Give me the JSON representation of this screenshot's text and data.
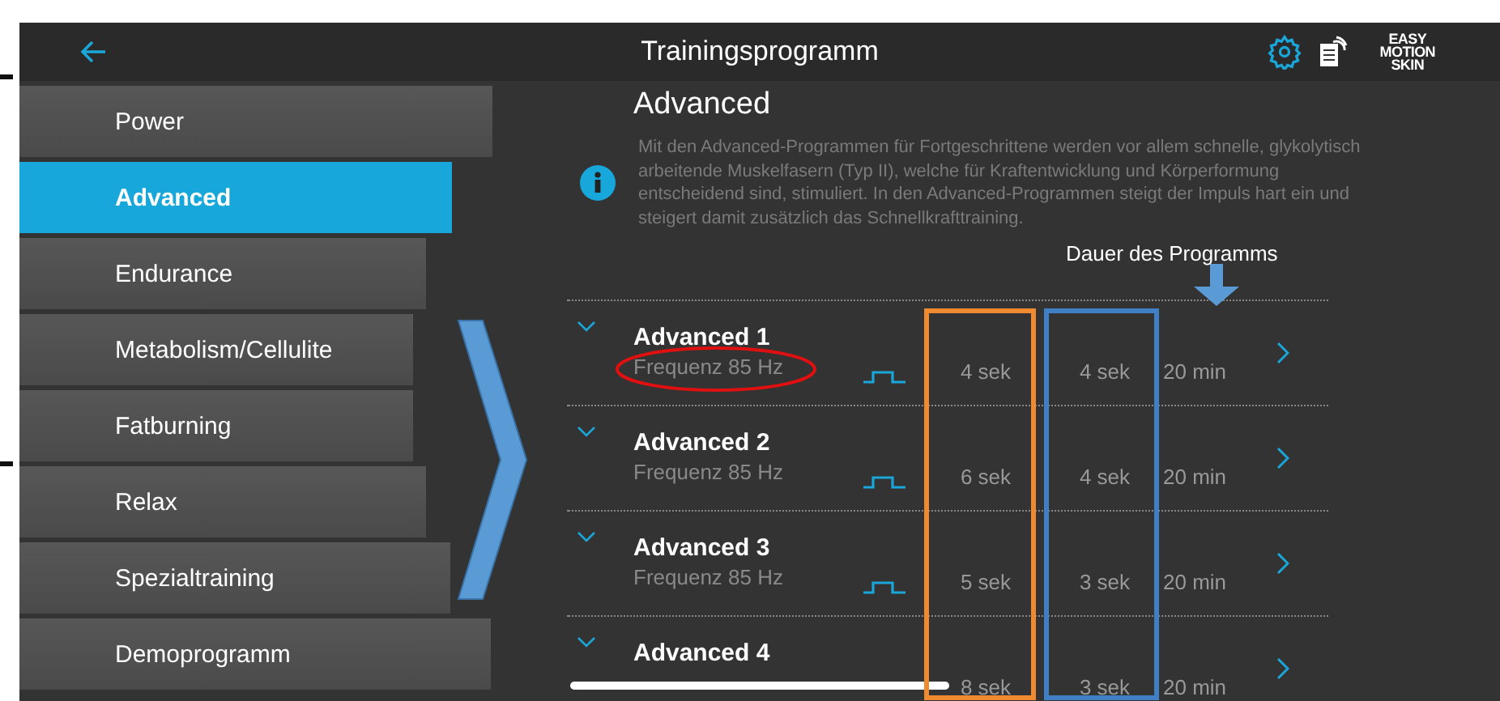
{
  "header": {
    "title": "Trainingsprogramm",
    "logo": [
      "EASY",
      "MOTION",
      "SKIN"
    ]
  },
  "sidebar": {
    "items": [
      {
        "label": "Power",
        "selected": false
      },
      {
        "label": "Advanced",
        "selected": true
      },
      {
        "label": "Endurance",
        "selected": false
      },
      {
        "label": "Metabolism/Cellulite",
        "selected": false
      },
      {
        "label": "Fatburning",
        "selected": false
      },
      {
        "label": "Relax",
        "selected": false
      },
      {
        "label": "Spezialtraining",
        "selected": false
      },
      {
        "label": "Demoprogramm",
        "selected": false
      }
    ]
  },
  "content": {
    "title": "Advanced",
    "description": "Mit den Advanced-Programmen für Fortgeschrittene werden vor allem schnelle, glykolytisch arbeitende Muskelfasern (Typ II), welche für Kraftentwicklung und Körperformung entscheidend sind, stimuliert. In den Advanced-Programmen steigt der Impuls hart ein und steigert damit zusätzlich das Schnellkrafttraining.",
    "programs": [
      {
        "name": "Advanced 1",
        "frequency": "Frequenz 85 Hz",
        "value_1": "4 sek",
        "value_2": "4 sek",
        "duration": "20 min"
      },
      {
        "name": "Advanced 2",
        "frequency": "Frequenz 85 Hz",
        "value_1": "6 sek",
        "value_2": "4 sek",
        "duration": "20 min"
      },
      {
        "name": "Advanced 3",
        "frequency": "Frequenz 85 Hz",
        "value_1": "5 sek",
        "value_2": "3 sek",
        "duration": "20 min"
      },
      {
        "name": "Advanced 4",
        "value_1": "8 sek",
        "value_2": "3 sek",
        "duration": "20 min"
      }
    ]
  },
  "annotation": {
    "label": "Dauer des Programms"
  }
}
